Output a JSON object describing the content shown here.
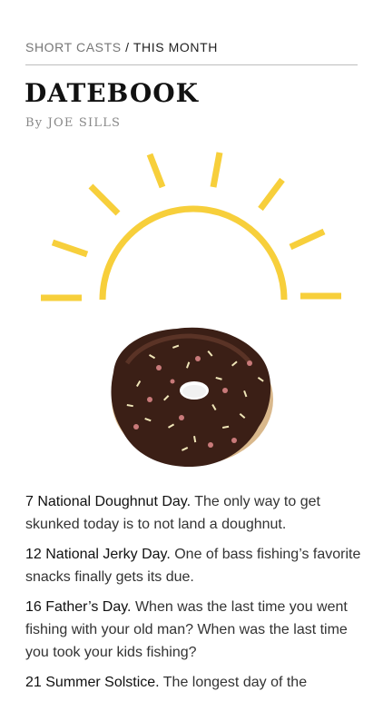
{
  "breadcrumb": {
    "section": "SHORT CASTS",
    "separator": " / ",
    "current": "THIS MONTH"
  },
  "article": {
    "title": "DATEBOOK",
    "byline": "By JOE SILLS"
  },
  "illustration": {
    "sun_color": "#F7CF3B",
    "icon": "sun-icon",
    "image": "chocolate-sprinkle-doughnut"
  },
  "entries": [
    {
      "heading": "7 National Doughnut Day.",
      "body": " The only way to get skunked today is to not land a doughnut."
    },
    {
      "heading": "12 National Jerky Day.",
      "body": " One of bass fishing’s favorite snacks finally gets its due."
    },
    {
      "heading": "16 Father’s Day.",
      "body": " When was the last time you went fishing with your old man? When was the last time you took your kids fishing?"
    },
    {
      "heading": "21 Summer Solstice.",
      "body": " The longest day of the"
    }
  ]
}
